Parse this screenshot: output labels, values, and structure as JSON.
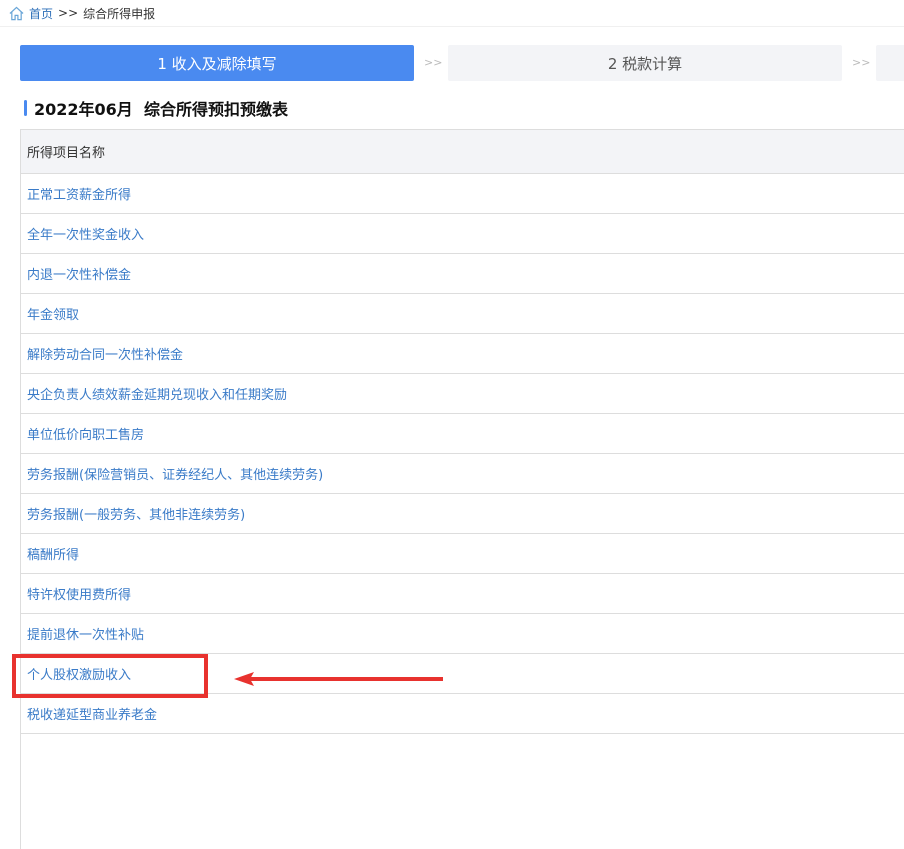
{
  "breadcrumb": {
    "home": "首页",
    "separator": ">>",
    "current": "综合所得申报"
  },
  "steps": [
    {
      "label": "1 收入及减除填写",
      "active": true
    },
    {
      "label": "2 税款计算",
      "active": false
    },
    {
      "label": "",
      "active": false
    }
  ],
  "step_separator": ">>",
  "section": {
    "title": "2022年06月  综合所得预扣预缴表"
  },
  "table": {
    "header": "所得项目名称",
    "rows": [
      "正常工资薪金所得",
      "全年一次性奖金收入",
      "内退一次性补偿金",
      "年金领取",
      "解除劳动合同一次性补偿金",
      "央企负责人绩效薪金延期兑现收入和任期奖励",
      "单位低价向职工售房",
      "劳务报酬(保险营销员、证券经纪人、其他连续劳务)",
      "劳务报酬(一般劳务、其他非连续劳务)",
      "稿酬所得",
      "特许权使用费所得",
      "提前退休一次性补贴",
      "个人股权激励收入",
      "税收递延型商业养老金"
    ]
  },
  "colors": {
    "accent": "#4a8af0",
    "link": "#3a7bc8",
    "highlight": "#e8322e"
  }
}
